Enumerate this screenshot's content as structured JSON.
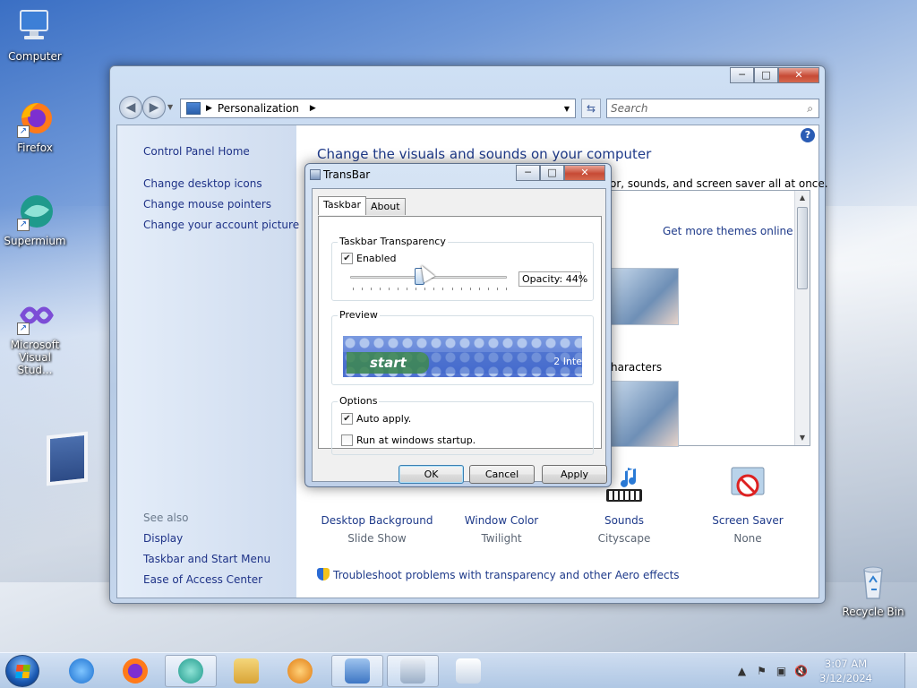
{
  "desktop": {
    "icons": [
      {
        "label": "Computer"
      },
      {
        "label": "Firefox"
      },
      {
        "label": "Supermium"
      },
      {
        "label": "Microsoft Visual Stud..."
      },
      {
        "label": "Recycle Bin"
      }
    ]
  },
  "window": {
    "address": "Personalization",
    "search_placeholder": "Search",
    "controls": {
      "minimize": "─",
      "maximize": "□",
      "close": "✕"
    }
  },
  "left_pane": {
    "home": "Control Panel Home",
    "links": [
      "Change desktop icons",
      "Change mouse pointers",
      "Change your account picture"
    ],
    "see_also_heading": "See also",
    "see_also": [
      "Display",
      "Taskbar and Start Menu",
      "Ease of Access Center"
    ]
  },
  "main": {
    "heading": "Change the visuals and sounds on your computer",
    "description_tail": "or, sounds, and screen saver all at once.",
    "get_more": "Get more themes online",
    "theme_label": "haracters",
    "bottom_items": [
      {
        "title": "Desktop Background",
        "subtitle": "Slide Show"
      },
      {
        "title": "Window Color",
        "subtitle": "Twilight"
      },
      {
        "title": "Sounds",
        "subtitle": "Cityscape"
      },
      {
        "title": "Screen Saver",
        "subtitle": "None"
      }
    ],
    "troubleshoot": "Troubleshoot problems with transparency and other Aero effects"
  },
  "dialog": {
    "title": "TransBar",
    "tabs": [
      "Taskbar",
      "About"
    ],
    "transparency_group": "Taskbar Transparency",
    "enabled_label": "Enabled",
    "enabled_checked": true,
    "opacity_label": "Opacity: 44%",
    "opacity_value": 0.44,
    "preview_group": "Preview",
    "preview_start": "start",
    "preview_tray": "2 Inte",
    "options_group": "Options",
    "auto_apply_label": "Auto apply.",
    "auto_apply_checked": true,
    "run_startup_label": "Run at windows startup.",
    "run_startup_checked": false,
    "ok": "OK",
    "cancel": "Cancel",
    "apply": "Apply"
  },
  "taskbar": {
    "time": "3:07 AM",
    "date": "3/12/2024",
    "apps": [
      "internet-explorer",
      "firefox",
      "supermium",
      "file-explorer",
      "media-player",
      "control-panel",
      "transbar",
      "notepad"
    ]
  }
}
